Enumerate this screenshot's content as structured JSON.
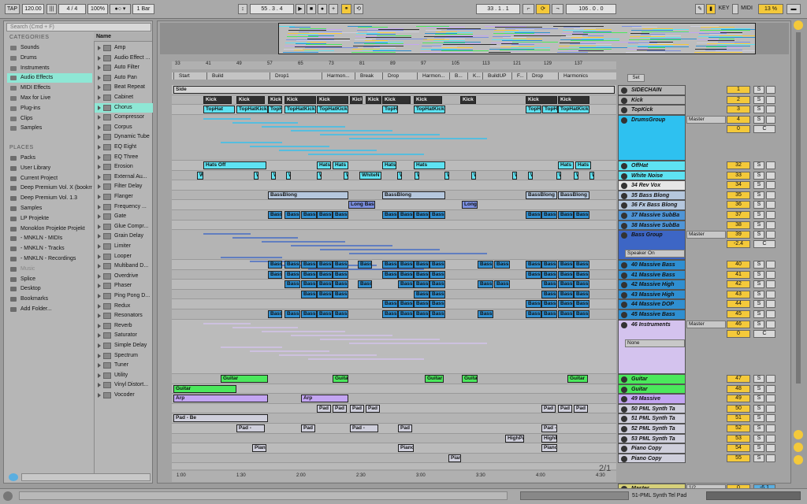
{
  "toolbar": {
    "tap": "TAP",
    "tempo": "120.00",
    "signature_num": "4",
    "signature_den": "4",
    "zoom": "100%",
    "quantize": "1 Bar",
    "position": "55 . 3 . 4",
    "loop_start": "33 . 1 . 1",
    "loop_length": "106 . 0 . 0",
    "key": "KEY",
    "midi": "MIDI",
    "cpu": "13 %"
  },
  "browser": {
    "search_placeholder": "Search (Cmd + F)",
    "categories_title": "CATEGORIES",
    "categories": [
      "Sounds",
      "Drums",
      "Instruments",
      "Audio Effects",
      "MIDI Effects",
      "Max for Live",
      "Plug-ins",
      "Clips",
      "Samples"
    ],
    "selected_category": "Audio Effects",
    "places_title": "PLACES",
    "places": [
      "Packs",
      "User Library",
      "Current Project",
      "Deep Premium Vol. X (bookm",
      "Deep Premium Vol. 1.3",
      "Samples",
      "LP Projekte",
      "Monoklon Projekte Projekt",
      "- MNKLN - MIDIs",
      "- MNKLN - Tracks",
      "- MNKLN - Recordings",
      "Music",
      "Splice",
      "Desktop",
      "Bookmarks",
      "Add Folder..."
    ],
    "name_header": "Name",
    "effects": [
      "Amp",
      "Audio Effect ...",
      "Auto Filter",
      "Auto Pan",
      "Beat Repeat",
      "Cabinet",
      "Chorus",
      "Compressor",
      "Corpus",
      "Dynamic Tube",
      "EQ Eight",
      "EQ Three",
      "Erosion",
      "External Au...",
      "Filter Delay",
      "Flanger",
      "Frequency ...",
      "Gate",
      "Glue Compr...",
      "Grain Delay",
      "Limiter",
      "Looper",
      "Multiband D...",
      "Overdrive",
      "Phaser",
      "Ping Pong D...",
      "Redux",
      "Resonators",
      "Reverb",
      "Saturator",
      "Simple Delay",
      "Spectrum",
      "Tuner",
      "Utility",
      "Vinyl Distort...",
      "Vocoder"
    ],
    "selected_effect": "Chorus"
  },
  "ruler": [
    "33",
    "41",
    "49",
    "57",
    "65",
    "73",
    "81",
    "89",
    "97",
    "105",
    "113",
    "121",
    "129",
    "137"
  ],
  "time_ruler": [
    "1:00",
    "1:30",
    "2:00",
    "2:30",
    "3:00",
    "3:30",
    "4:00",
    "4:30"
  ],
  "locators": [
    "Start",
    "Build",
    "Drop1",
    "Harmon...",
    "Break",
    "Drop",
    "Harmon...",
    "B...",
    "K...",
    "BuildUP",
    "F...",
    "Drop",
    "Harmonics"
  ],
  "set_label": "Set",
  "page_indicator": "2/1",
  "tracks": [
    {
      "name": "SIDECHAIN",
      "num": "1",
      "color": "#b5b5b5"
    },
    {
      "name": "Kick",
      "num": "2",
      "color": "#b5b5b5"
    },
    {
      "name": "TopKick",
      "num": "3",
      "color": "#b5b5b5"
    },
    {
      "name": "DrumsGroup",
      "num": "4",
      "color": "#2ec1f0",
      "routing": "Master",
      "vol": "0",
      "pan": "C"
    },
    {
      "name": "OffHat",
      "num": "32",
      "color": "#5ee2f2"
    },
    {
      "name": "White Noise",
      "num": "33",
      "color": "#5ee2f2"
    },
    {
      "name": "34 Rev Vox",
      "num": "34",
      "color": "#e6e6e6"
    },
    {
      "name": "35 Bass Blong",
      "num": "35",
      "color": "#b5c7dd"
    },
    {
      "name": "36 Fx Bass Blong",
      "num": "36",
      "color": "#b5c7dd"
    },
    {
      "name": "37 Massive SubBa",
      "num": "37",
      "color": "#4f95d6"
    },
    {
      "name": "38 Massive SubBa",
      "num": "38",
      "color": "#4f95d6"
    },
    {
      "name": "Bass Group",
      "num": "39",
      "color": "#3d66c5",
      "routing": "Master",
      "vol": "-2.4",
      "pan": "C",
      "output": "Speaker On"
    },
    {
      "name": "40 Massive Bass",
      "num": "40",
      "color": "#2f8fd1"
    },
    {
      "name": "41 Massive Bass",
      "num": "41",
      "color": "#2f8fd1"
    },
    {
      "name": "42 Massive High",
      "num": "42",
      "color": "#2f8fd1"
    },
    {
      "name": "43 Massive High",
      "num": "43",
      "color": "#2f8fd1"
    },
    {
      "name": "44 Massive DOP",
      "num": "44",
      "color": "#2f8fd1"
    },
    {
      "name": "45 Massive Bass",
      "num": "45",
      "color": "#2f8fd1"
    },
    {
      "name": "46 Instruments",
      "num": "46",
      "color": "#d4c3ee",
      "routing": "Master",
      "vol": "0",
      "pan": "C",
      "output": "None"
    },
    {
      "name": "Guitar",
      "num": "47",
      "color": "#4be85c"
    },
    {
      "name": "Guitar",
      "num": "48",
      "color": "#4be85c"
    },
    {
      "name": "49 Massive",
      "num": "49",
      "color": "#c3a5f2"
    },
    {
      "name": "50 PML Synth Ta",
      "num": "50",
      "color": "#cfcfdc"
    },
    {
      "name": "51 PML Synth Ta",
      "num": "51",
      "color": "#cfcfdc"
    },
    {
      "name": "52 PML Synth Ta",
      "num": "52",
      "color": "#cfcfdc"
    },
    {
      "name": "53 PML Synth Ta",
      "num": "53",
      "color": "#cfcfdc"
    },
    {
      "name": "Piano Copy",
      "num": "54",
      "color": "#cfcfdc"
    },
    {
      "name": "Piano Copy",
      "num": "55",
      "color": "#cfcfdc"
    }
  ],
  "master": {
    "name": "Master",
    "routing": "1/2",
    "vol": "0",
    "pan": "-6.1"
  },
  "clips": [
    {
      "label": "Side",
      "color": "#d6d6d6"
    },
    {
      "label": "Kick",
      "color": "#303030"
    },
    {
      "label": "TopHat",
      "color": "#5ee2f2"
    },
    {
      "label": "TopHatKick",
      "color": "#5ee2f2"
    },
    {
      "label": "Hats Off",
      "color": "#5ee2f2"
    },
    {
      "label": "Hats",
      "color": "#5ee2f2"
    },
    {
      "label": "WhiteN",
      "color": "#5ee2f2"
    },
    {
      "label": "BassBlong",
      "color": "#b5c7dd"
    },
    {
      "label": "Long Bass",
      "color": "#7b8fe0"
    },
    {
      "label": "Long",
      "color": "#7b8fe0"
    },
    {
      "label": "Bass",
      "color": "#2f8fd1"
    },
    {
      "label": "Guitar",
      "color": "#4be85c"
    },
    {
      "label": "Arp",
      "color": "#c3a5f2"
    },
    {
      "label": "Pad - Be",
      "color": "#cfcfdc"
    },
    {
      "label": "Pad -",
      "color": "#cfcfdc"
    },
    {
      "label": "HighPa",
      "color": "#cfcfdc"
    },
    {
      "label": "HighP",
      "color": "#cfcfdc"
    },
    {
      "label": "Piano",
      "color": "#cfcfdc"
    },
    {
      "label": "Pian",
      "color": "#cfcfdc"
    }
  ],
  "statusbar": {
    "track_label": "51-PML Synth Tel Pad"
  }
}
